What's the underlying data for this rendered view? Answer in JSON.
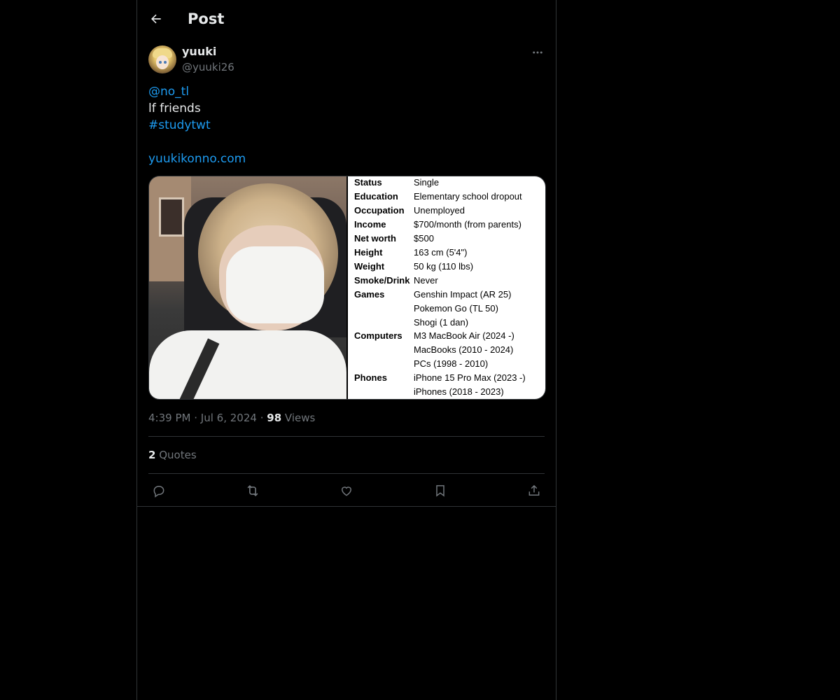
{
  "header": {
    "title": "Post"
  },
  "post": {
    "author": {
      "name": "yuuki",
      "handle": "@yuuki26"
    },
    "lines": {
      "mention": "@no_tl",
      "text": "lf friends",
      "hashtag": "#studytwt",
      "url": "yuukikonno.com"
    },
    "image_profile": [
      {
        "key": "Status",
        "value": "Single"
      },
      {
        "key": "Education",
        "value": "Elementary school dropout"
      },
      {
        "key": "Occupation",
        "value": "Unemployed"
      },
      {
        "key": "Income",
        "value": "$700/month (from parents)"
      },
      {
        "key": "Net worth",
        "value": "$500"
      },
      {
        "key": "Height",
        "value": "163 cm (5'4\")"
      },
      {
        "key": "Weight",
        "value": "50 kg (110 lbs)"
      },
      {
        "key": "Smoke/Drink",
        "value": "Never"
      },
      {
        "key": "Games",
        "value": "Genshin Impact (AR 25)"
      },
      {
        "key": "",
        "value": "Pokemon Go (TL 50)"
      },
      {
        "key": "",
        "value": "Shogi (1 dan)"
      },
      {
        "key": "Computers",
        "value": "M3 MacBook Air (2024 -)"
      },
      {
        "key": "",
        "value": "MacBooks (2010 - 2024)"
      },
      {
        "key": "",
        "value": "PCs (1998 - 2010)"
      },
      {
        "key": "Phones",
        "value": "iPhone 15 Pro Max (2023 -)"
      },
      {
        "key": "",
        "value": "iPhones (2018 - 2023)"
      }
    ],
    "meta": {
      "time": "4:39 PM",
      "sep": "·",
      "date": "Jul 6, 2024",
      "views_count": "98",
      "views_label": "Views"
    },
    "quotes": {
      "count": "2",
      "label": "Quotes"
    }
  },
  "icons": [
    "back-arrow-icon",
    "more-icon",
    "reply-icon",
    "repost-icon",
    "like-icon",
    "bookmark-icon",
    "share-icon"
  ],
  "colors": {
    "accent": "#1d9bf0",
    "text": "#e7e9ea",
    "muted": "#71767b",
    "border": "#2f3336",
    "background": "#000000"
  }
}
